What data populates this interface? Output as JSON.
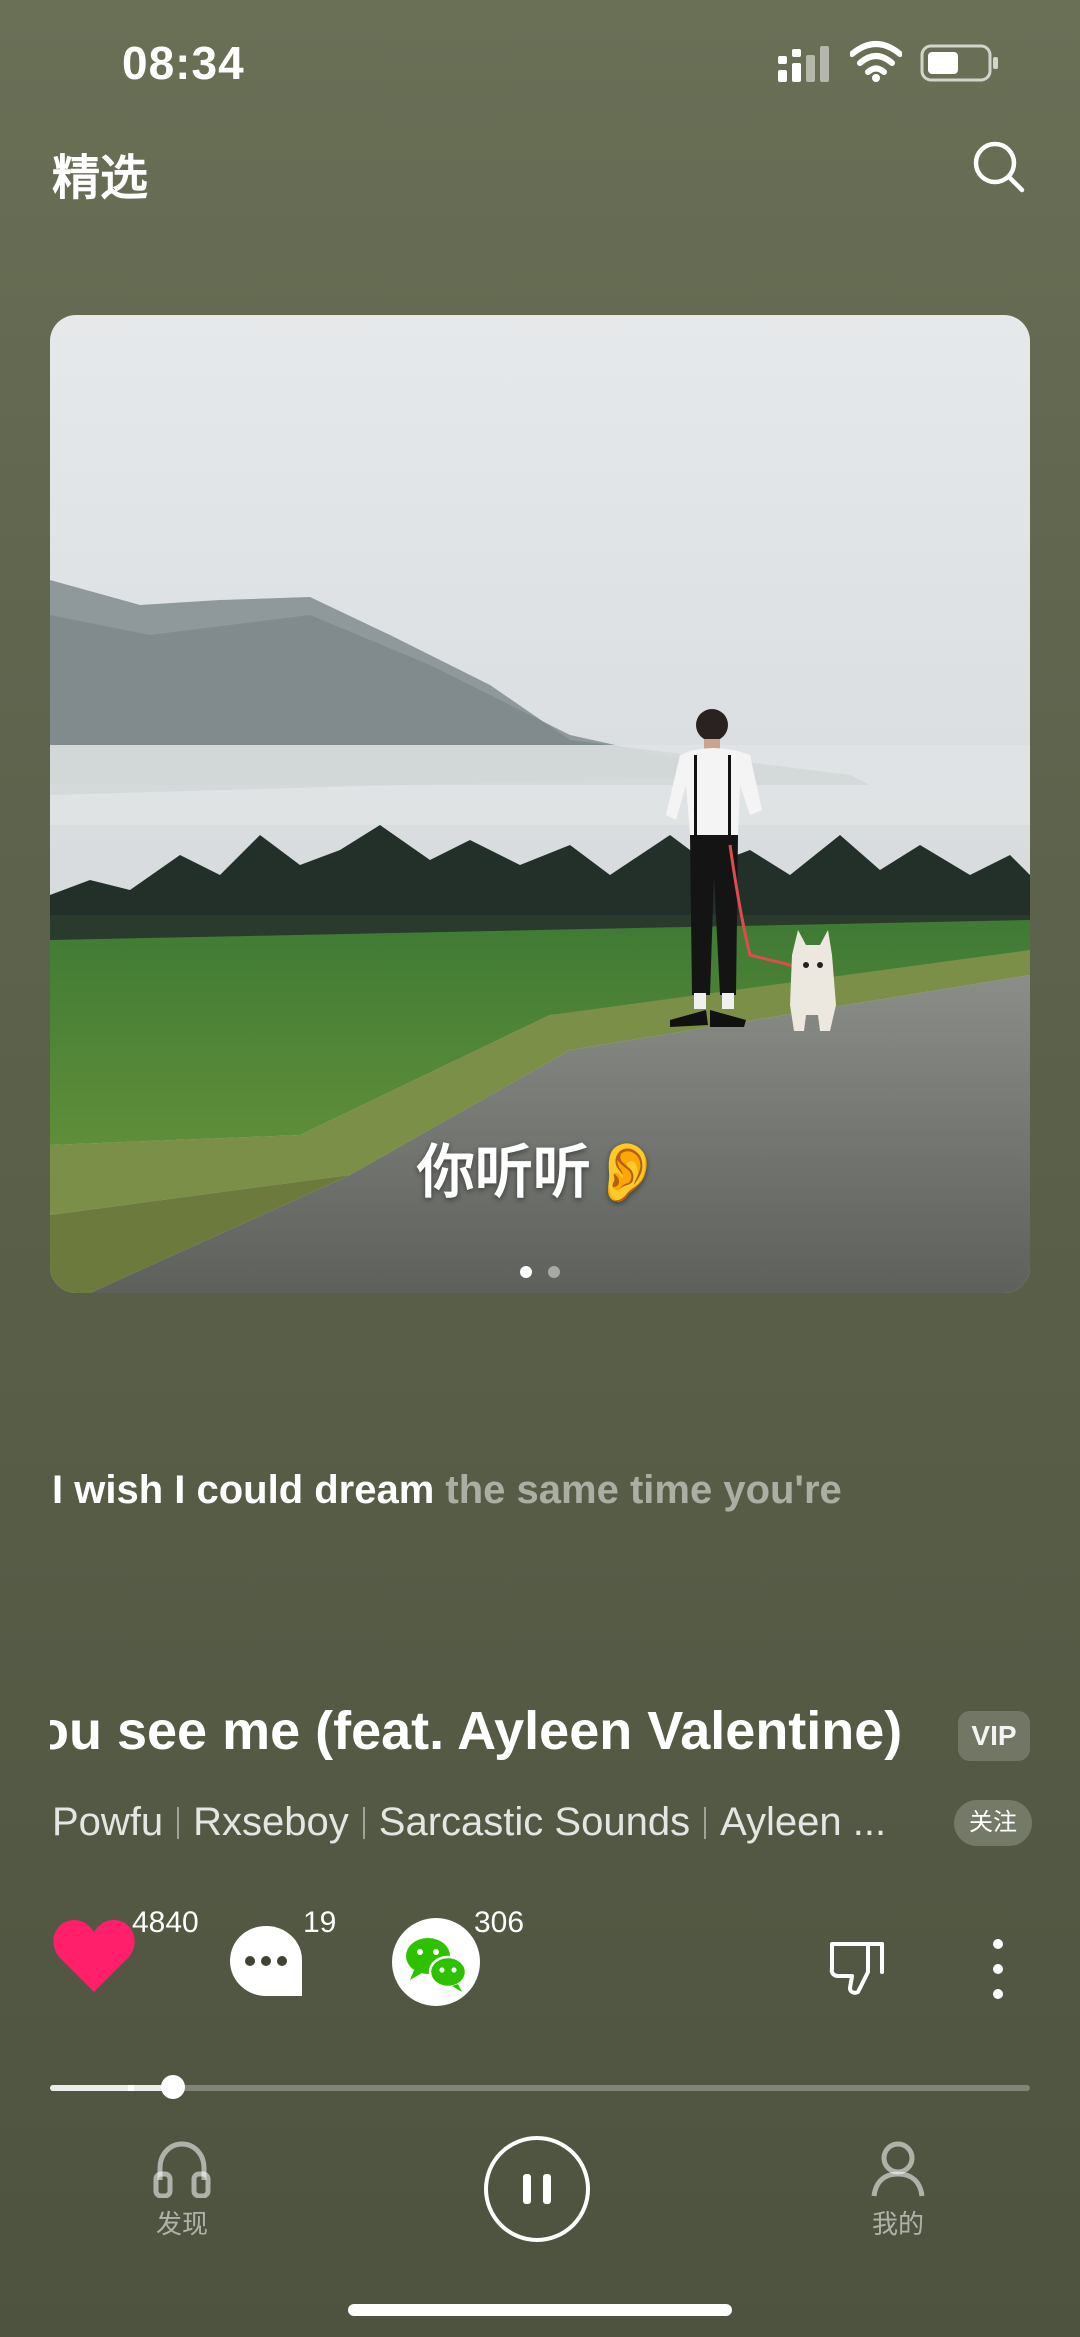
{
  "status_bar": {
    "time": "08:34"
  },
  "header": {
    "title": "精选"
  },
  "album": {
    "caption": "你听听👂",
    "page_count": 2,
    "active_page": 1
  },
  "lyrics": {
    "sung": "I wish I could dream",
    "rest": " the same time you're"
  },
  "song": {
    "title": "ou see me (feat. Ayleen Valentine)",
    "vip_label": "VIP",
    "artists": [
      "Powfu",
      "Rxseboy",
      "Sarcastic Sounds",
      "Ayleen ..."
    ],
    "follow_label": "关注"
  },
  "actions": {
    "likes": "4840",
    "comments": "19",
    "shares": "306"
  },
  "progress": {
    "fraction": 0.125,
    "buffered_fraction": 0.08
  },
  "nav": {
    "discover": "发现",
    "mine": "我的"
  },
  "colors": {
    "like": "#ff1f6b",
    "wechat": "#2dc100",
    "background": "#5d634c"
  }
}
